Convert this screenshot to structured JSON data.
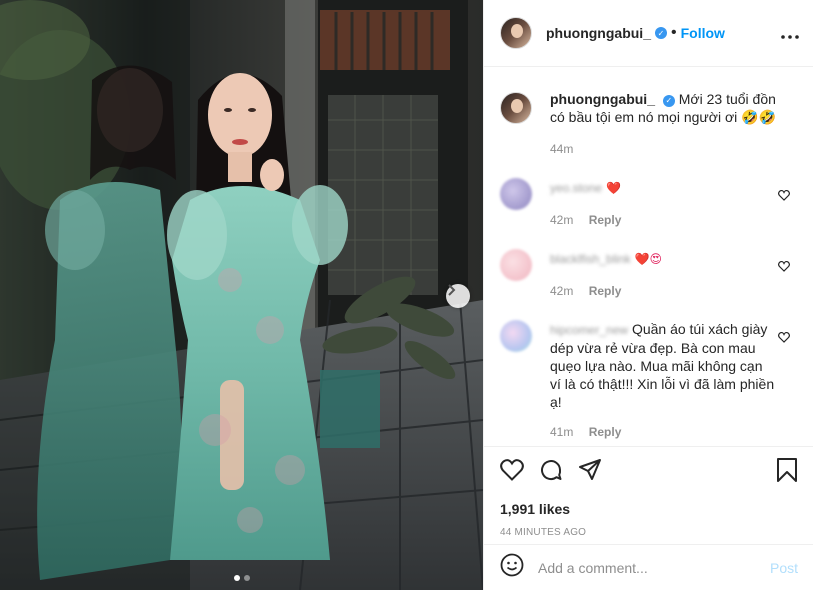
{
  "header": {
    "username": "phuongngabui_",
    "separator": "•",
    "follow_label": "Follow",
    "more_label": "•••"
  },
  "caption": {
    "username": "phuongngabui_",
    "text": "Mới 23 tuổi đồn có bầu tội em nó mọi người ơi 🤣🤣",
    "time": "44m"
  },
  "comments": [
    {
      "username": "yeo.stone",
      "text": "❤️",
      "time": "42m",
      "reply_label": "Reply"
    },
    {
      "username": "blacklfish_blink",
      "text": "❤️😍",
      "time": "42m",
      "reply_label": "Reply"
    },
    {
      "username": "hipcomer_new",
      "text": "Quần áo túi xách giày dép vừa rẻ vừa đẹp. Bà con mau quẹo lựa nào. Mua mãi không cạn ví là có thật!!! Xin lỗi vì đã làm phiền ạ!",
      "time": "41m",
      "reply_label": "Reply"
    }
  ],
  "post": {
    "likes": "1,991 likes",
    "timestamp": "44 MINUTES AGO"
  },
  "add_comment": {
    "placeholder": "Add a comment...",
    "post_label": "Post"
  },
  "carousel": {
    "current": 1,
    "total": 2
  },
  "icons": [
    "heart-icon",
    "comment-icon",
    "share-icon",
    "bookmark-icon",
    "emoji-icon",
    "chevron-right-icon",
    "more-icon",
    "verified-badge-icon"
  ],
  "colors": {
    "link_blue": "#0095f6",
    "verified_blue": "#3897f0",
    "muted": "#8e8e8e",
    "post_disabled": "#b2dffc"
  }
}
